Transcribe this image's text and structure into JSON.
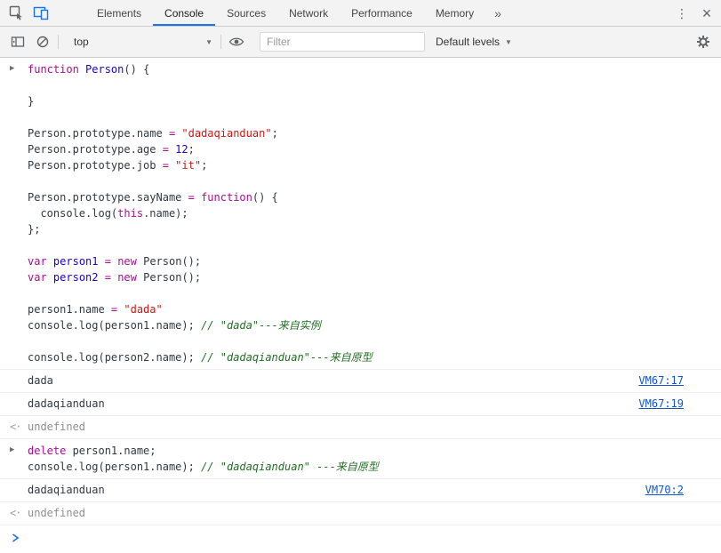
{
  "header": {
    "tabs": [
      {
        "label": "Elements",
        "active": false
      },
      {
        "label": "Console",
        "active": true
      },
      {
        "label": "Sources",
        "active": false
      },
      {
        "label": "Network",
        "active": false
      },
      {
        "label": "Performance",
        "active": false
      },
      {
        "label": "Memory",
        "active": false
      }
    ],
    "overflow_chevron": "»"
  },
  "console_toolbar": {
    "context": "top",
    "filter_placeholder": "Filter",
    "levels": "Default levels"
  },
  "icons": {
    "kebab": "⋮",
    "close": "×",
    "caret_down": "▼",
    "expand_triangle": "▶",
    "return_marker": "<·"
  },
  "colors": {
    "accent_blue": "#1a73e8",
    "keyword": "#aa0d91",
    "definition": "#1c00cf",
    "number": "#1c00cf",
    "string": "#c41a16",
    "comment": "#236e25",
    "link": "#1155cc",
    "result_gray": "#8e8e8e",
    "toolbar_bg": "#f3f3f3",
    "border": "#cccccc",
    "row_border": "#f0f0f0"
  },
  "messages": [
    {
      "type": "input",
      "lines": [
        [
          {
            "t": "function",
            "c": "kw"
          },
          {
            "t": " ",
            "c": "pl"
          },
          {
            "t": "Person",
            "c": "df"
          },
          {
            "t": "() {",
            "c": "pl"
          }
        ],
        [],
        [
          {
            "t": "}",
            "c": "pl"
          }
        ],
        [],
        [
          {
            "t": "Person.prototype.name ",
            "c": "pl"
          },
          {
            "t": "= ",
            "c": "kw"
          },
          {
            "t": "\"dadaqianduan\"",
            "c": "st"
          },
          {
            "t": ";",
            "c": "pl"
          }
        ],
        [
          {
            "t": "Person.prototype.age ",
            "c": "pl"
          },
          {
            "t": "= ",
            "c": "kw"
          },
          {
            "t": "12",
            "c": "nm"
          },
          {
            "t": ";",
            "c": "pl"
          }
        ],
        [
          {
            "t": "Person.prototype.job ",
            "c": "pl"
          },
          {
            "t": "= ",
            "c": "kw"
          },
          {
            "t": "\"it\"",
            "c": "st"
          },
          {
            "t": ";",
            "c": "pl"
          }
        ],
        [],
        [
          {
            "t": "Person.prototype.sayName ",
            "c": "pl"
          },
          {
            "t": "= ",
            "c": "kw"
          },
          {
            "t": "function",
            "c": "kw"
          },
          {
            "t": "() {",
            "c": "pl"
          }
        ],
        [
          {
            "t": "  console.log(",
            "c": "pl"
          },
          {
            "t": "this",
            "c": "kw"
          },
          {
            "t": ".name);",
            "c": "pl"
          }
        ],
        [
          {
            "t": "};",
            "c": "pl"
          }
        ],
        [],
        [
          {
            "t": "var",
            "c": "kw"
          },
          {
            "t": " ",
            "c": "pl"
          },
          {
            "t": "person1",
            "c": "df"
          },
          {
            "t": " ",
            "c": "pl"
          },
          {
            "t": "= ",
            "c": "kw"
          },
          {
            "t": "new",
            "c": "kw"
          },
          {
            "t": " Person();",
            "c": "pl"
          }
        ],
        [
          {
            "t": "var",
            "c": "kw"
          },
          {
            "t": " ",
            "c": "pl"
          },
          {
            "t": "person2",
            "c": "df"
          },
          {
            "t": " ",
            "c": "pl"
          },
          {
            "t": "= ",
            "c": "kw"
          },
          {
            "t": "new",
            "c": "kw"
          },
          {
            "t": " Person();",
            "c": "pl"
          }
        ],
        [],
        [
          {
            "t": "person1.name ",
            "c": "pl"
          },
          {
            "t": "= ",
            "c": "kw"
          },
          {
            "t": "\"dada\"",
            "c": "st"
          }
        ],
        [
          {
            "t": "console.log(person1.name); ",
            "c": "pl"
          },
          {
            "t": "// \"dada\"---来自实例",
            "c": "cm"
          }
        ],
        [],
        [
          {
            "t": "console.log(person2.name); ",
            "c": "pl"
          },
          {
            "t": "// \"dadaqianduan\"---来自原型",
            "c": "cm"
          }
        ]
      ]
    },
    {
      "type": "log",
      "text": "dada",
      "link": "VM67:17"
    },
    {
      "type": "log",
      "text": "dadaqianduan",
      "link": "VM67:19"
    },
    {
      "type": "result",
      "text": "undefined"
    },
    {
      "type": "input",
      "lines": [
        [
          {
            "t": "delete",
            "c": "kw"
          },
          {
            "t": " person1.name;",
            "c": "pl"
          }
        ],
        [
          {
            "t": "console.log(person1.name); ",
            "c": "pl"
          },
          {
            "t": "// \"dadaqianduan\" ---来自原型",
            "c": "cm"
          }
        ]
      ]
    },
    {
      "type": "log",
      "text": "dadaqianduan",
      "link": "VM70:2"
    },
    {
      "type": "result",
      "text": "undefined"
    }
  ]
}
